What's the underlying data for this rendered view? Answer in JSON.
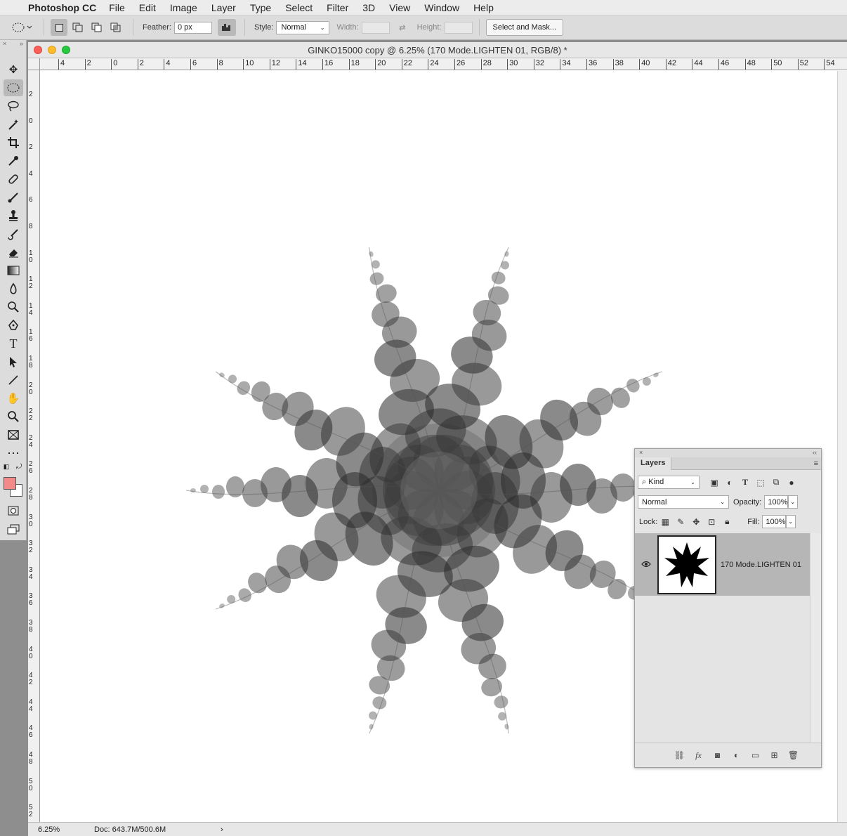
{
  "menubar": {
    "app_name": "Photoshop CC",
    "items": [
      "File",
      "Edit",
      "Image",
      "Layer",
      "Type",
      "Select",
      "Filter",
      "3D",
      "View",
      "Window",
      "Help"
    ]
  },
  "options": {
    "feather_label": "Feather:",
    "feather_value": "0 px",
    "style_label": "Style:",
    "style_value": "Normal",
    "width_label": "Width:",
    "height_label": "Height:",
    "select_mask_label": "Select and Mask..."
  },
  "document": {
    "title": "GINKO15000 copy @ 6.25% (170 Mode.LIGHTEN 01, RGB/8) *",
    "zoom": "6.25%",
    "doc_size": "Doc: 643.7M/500.6M",
    "status_arrow": "›"
  },
  "ruler": {
    "h_labels": [
      "4",
      "2",
      "0",
      "2",
      "4",
      "6",
      "8",
      "10",
      "12",
      "14",
      "16",
      "18",
      "20",
      "22",
      "24",
      "26",
      "28",
      "30",
      "32",
      "34",
      "36",
      "38",
      "40",
      "42",
      "44",
      "46",
      "48",
      "50",
      "52",
      "54"
    ],
    "v_labels": [
      "2",
      "0",
      "2",
      "4",
      "6",
      "8",
      "10",
      "12",
      "14",
      "16",
      "18",
      "20",
      "22",
      "24",
      "26",
      "28",
      "30",
      "32",
      "34",
      "36",
      "38",
      "40",
      "42",
      "44",
      "46",
      "48",
      "50",
      "52"
    ]
  },
  "layers_panel": {
    "tab_label": "Layers",
    "filter_kind": "Kind",
    "blend_mode": "Normal",
    "opacity_label": "Opacity:",
    "opacity_value": "100%",
    "lock_label": "Lock:",
    "fill_label": "Fill:",
    "fill_value": "100%",
    "layers": [
      {
        "name": "170 Mode.LIGHTEN 01",
        "visible": true
      }
    ]
  },
  "colors": {
    "foreground": "#f28a8a",
    "background": "#ffffff"
  }
}
